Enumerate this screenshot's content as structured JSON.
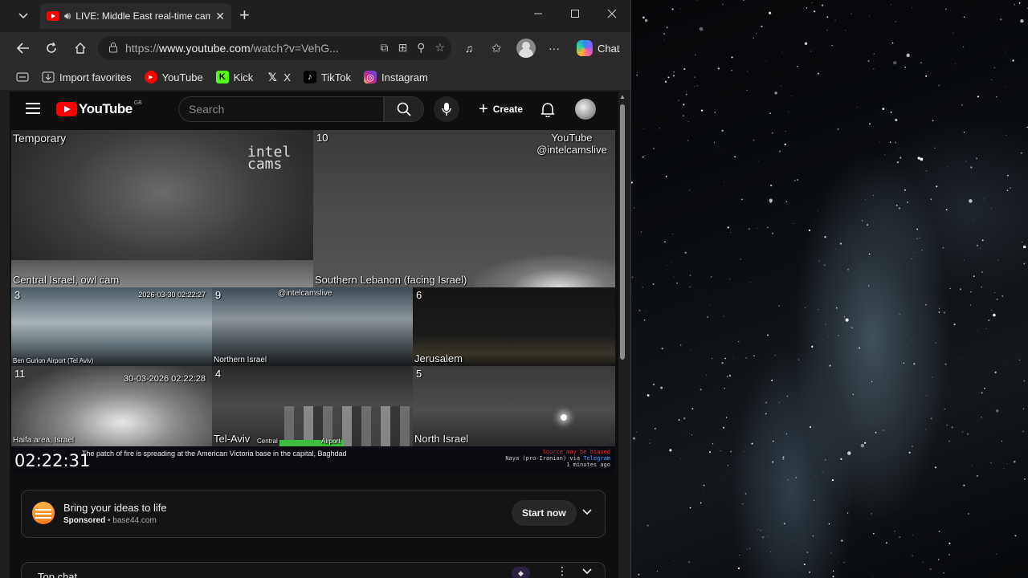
{
  "tab": {
    "title": "LIVE: Middle East real-time cam"
  },
  "address_bar": {
    "url_prefix": "https://",
    "url_host": "www.youtube.com",
    "url_path": "/watch?v=VehG..."
  },
  "chat_button": {
    "label": "Chat"
  },
  "bookmarks": [
    {
      "label": "Import favorites",
      "icon": "import-icon"
    },
    {
      "label": "YouTube",
      "icon": "youtube-icon"
    },
    {
      "label": "Kick",
      "icon": "kick-icon"
    },
    {
      "label": "X",
      "icon": "x-icon"
    },
    {
      "label": "TikTok",
      "icon": "tiktok-icon"
    },
    {
      "label": "Instagram",
      "icon": "instagram-icon"
    }
  ],
  "youtube": {
    "logo_text": "YouTube",
    "country_code": "GB",
    "search_placeholder": "Search",
    "create_label": "Create"
  },
  "video": {
    "cams": [
      {
        "num": "",
        "label": "Temporary",
        "bottom_label": "Central Israel, owl cam",
        "watermark": "intel cams"
      },
      {
        "num": "10",
        "label": "YouTube @intelcamslive",
        "bottom_label": "Southern Lebanon (facing Israel)"
      },
      {
        "num": "3",
        "timestamp": "2026-03-30 02:22:27",
        "bottom_label": "Ben Gurion Airport (Tel Aviv)"
      },
      {
        "num": "9",
        "top_label": "@intelcamslive",
        "bottom_label": "Northern Israel"
      },
      {
        "num": "6",
        "bottom_label": "Jerusalem"
      },
      {
        "num": "11",
        "timestamp": "30-03-2026 02:22:28",
        "bottom_label": "Haifa area, Israel"
      },
      {
        "num": "4",
        "bottom_label": "Tel-Aviv",
        "sub_label_1": "Central",
        "sub_label_2": "Airport"
      },
      {
        "num": "5",
        "bottom_label": "North Israel"
      }
    ],
    "ticker": {
      "clock": "02:22:31",
      "headline": "The patch of fire is spreading at the American Victoria base in the capital, Baghdad",
      "source_warning": "Source may be biased",
      "source_name": "Naya (pro-Iranian) via",
      "source_channel": "Telegram",
      "source_time": "1 minutes ago"
    }
  },
  "ad": {
    "title": "Bring your ideas to life",
    "sponsored": "Sponsored",
    "domain": "base44.com",
    "cta": "Start now"
  },
  "top_chat": {
    "title": "Top chat"
  },
  "colors": {
    "youtube_red": "#ff0000",
    "browser_chrome": "#2b2b2b",
    "page_bg": "#0f0f0f"
  }
}
